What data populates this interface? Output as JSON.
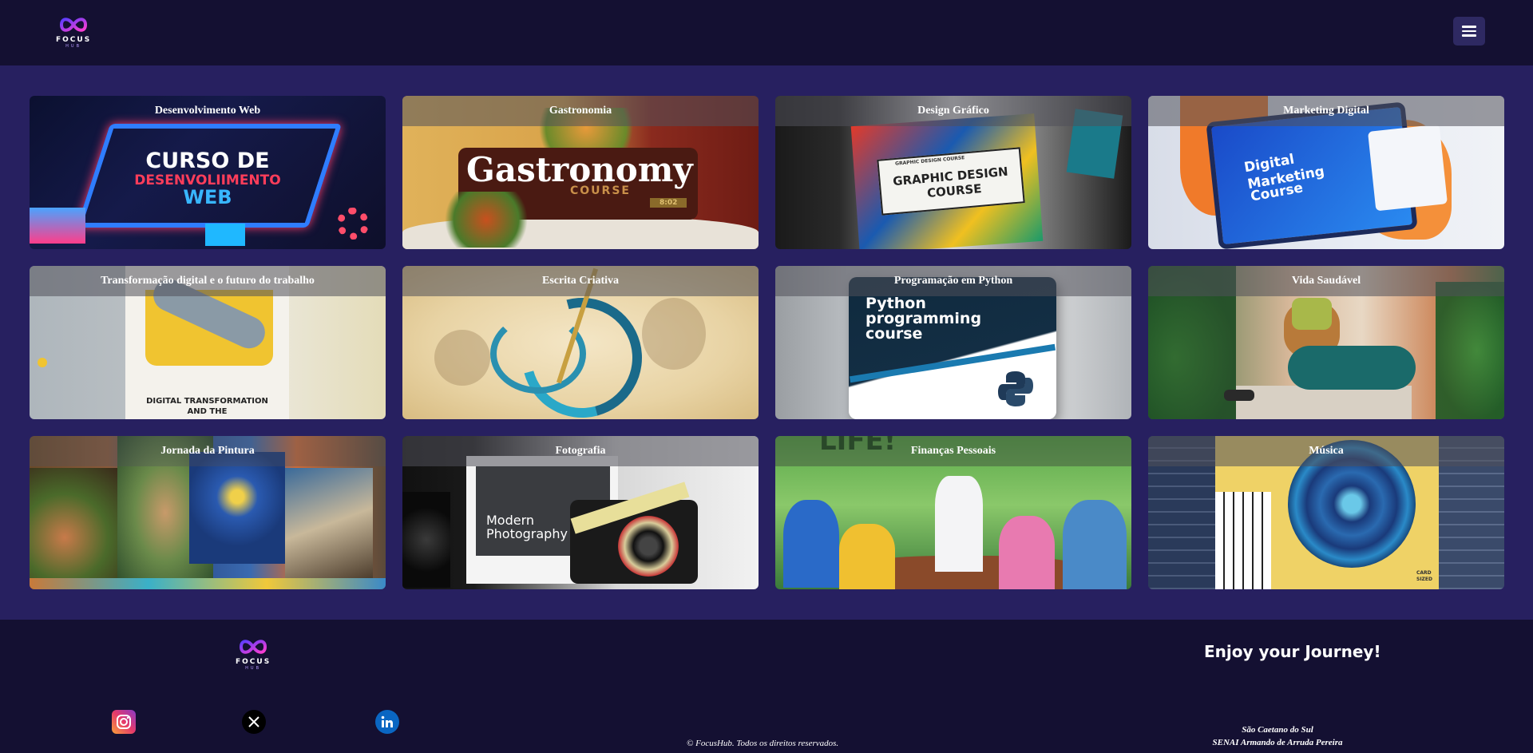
{
  "header": {
    "logo_text": "FOCUS",
    "logo_sub": "HUB",
    "menu_icon": "hamburger-menu-icon"
  },
  "courses": [
    {
      "title": "Desenvolvimento Web",
      "art": [
        "CURSO DE",
        "DESENVOLIIMENTO",
        "WEB"
      ]
    },
    {
      "title": "Gastronomia",
      "art": [
        "Gastronomy",
        "COURSE",
        "8:02"
      ]
    },
    {
      "title": "Design Gráfico",
      "art": [
        "GRAPHIC DESIGN COURSE",
        "GRAPHIC DESIGN",
        "COURSE"
      ]
    },
    {
      "title": "Marketing Digital",
      "art": [
        "Digital",
        "Marketing",
        "Course"
      ]
    },
    {
      "title": "Transformação digital e o futuro do trabalho",
      "art": [
        "DIGITAL TRANSFORMATION",
        "AND THE"
      ]
    },
    {
      "title": "Escrita Criativa",
      "art": []
    },
    {
      "title": "Programação em Python",
      "art": [
        "Python",
        "programming",
        "course"
      ]
    },
    {
      "title": "Vida Saudável",
      "art": []
    },
    {
      "title": "Jornada da Pintura",
      "art": []
    },
    {
      "title": "Fotografia",
      "art": [
        "Modern",
        "Photography"
      ]
    },
    {
      "title": "Finanças Pessoais",
      "art": [
        "LIFE!"
      ]
    },
    {
      "title": "Música",
      "art": [
        "CARD",
        "SIZED"
      ]
    }
  ],
  "footer": {
    "logo_text": "FOCUS",
    "logo_sub": "HUB",
    "tagline": "Enjoy your Journey!",
    "copyright": "© FocusHub. Todos os direitos reservados.",
    "address_line1": "São Caetano do Sul",
    "address_line2": "SENAI Armando de Arruda Pereira",
    "social": [
      {
        "name": "instagram-icon"
      },
      {
        "name": "x-icon"
      },
      {
        "name": "linkedin-icon"
      }
    ]
  },
  "colors": {
    "header_bg": "#141032",
    "page_bg": "#272060",
    "accent": "#a86bff"
  }
}
